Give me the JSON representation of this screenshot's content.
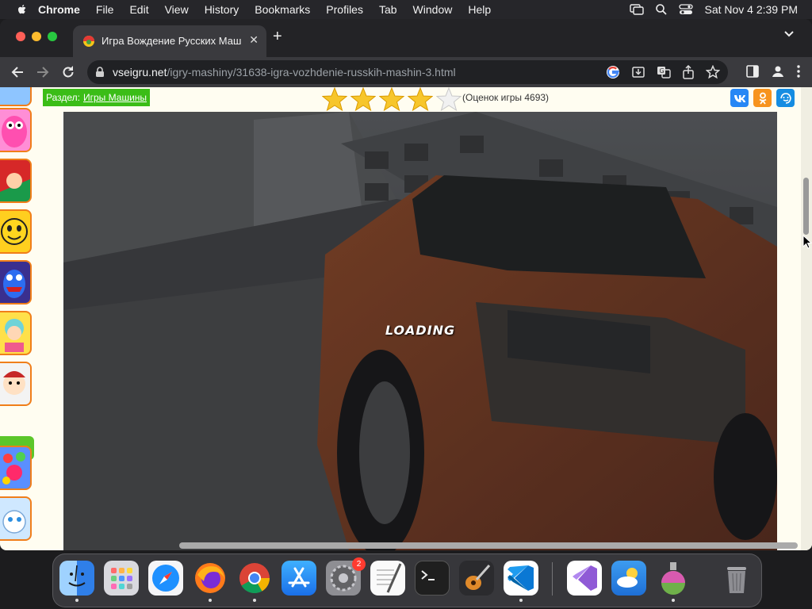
{
  "menubar": {
    "app": "Chrome",
    "items": [
      "File",
      "Edit",
      "View",
      "History",
      "Bookmarks",
      "Profiles",
      "Tab",
      "Window",
      "Help"
    ],
    "clock": "Sat Nov 4  2:39 PM"
  },
  "browser": {
    "tab_title": "Игра Вождение Русских Маш",
    "url_host": "vseigru.net",
    "url_path": "/igry-mashiny/31638-igra-vozhdenie-russkih-mashin-3.html"
  },
  "page": {
    "section_label": "Раздел:",
    "section_link": "Игры Машины",
    "rating_text": "(Оценок игры 4693)",
    "rating_stars_filled": 4,
    "rating_stars_total": 5,
    "social": [
      "vk",
      "ok",
      "mail"
    ],
    "game_status": "LOADING"
  },
  "dock": {
    "apps": [
      "Finder",
      "Launchpad",
      "Safari",
      "Firefox",
      "Chrome",
      "App Store",
      "System Settings",
      "TextEdit",
      "Terminal",
      "GarageBand",
      "Visual Studio Code",
      "Visual Studio",
      "Weather",
      "Installer",
      "Trash"
    ],
    "settings_badge": "2"
  },
  "colors": {
    "accent_green": "#3bbd17",
    "thumb_border": "#f07e1a",
    "star": "#f7c62b"
  }
}
